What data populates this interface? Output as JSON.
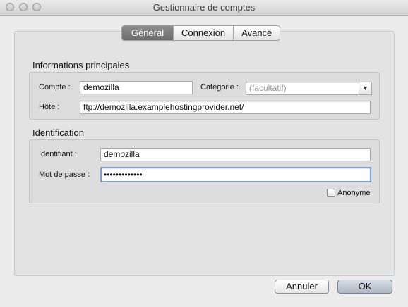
{
  "window": {
    "title": "Gestionnaire de comptes"
  },
  "tabs": [
    {
      "label": "Général",
      "active": true
    },
    {
      "label": "Connexion",
      "active": false
    },
    {
      "label": "Avancé",
      "active": false
    }
  ],
  "main_info": {
    "title": "Informations principales",
    "account_label": "Compte :",
    "account_value": "demozilla",
    "category_label": "Categorie :",
    "category_value": "(facultatif)",
    "host_label": "Hôte :",
    "host_value": "ftp://demozilla.examplehostingprovider.net/"
  },
  "identification": {
    "title": "Identification",
    "username_label": "Identifiant :",
    "username_value": "demozilla",
    "password_label": "Mot de passe :",
    "password_value": "•••••••••••••",
    "anonymous_label": "Anonyme",
    "anonymous_checked": false
  },
  "buttons": {
    "cancel": "Annuler",
    "ok": "OK"
  },
  "icons": {
    "combo_arrow": "chevron-down-icon",
    "window_controls": [
      "close-icon",
      "minimize-icon",
      "zoom-icon"
    ]
  }
}
